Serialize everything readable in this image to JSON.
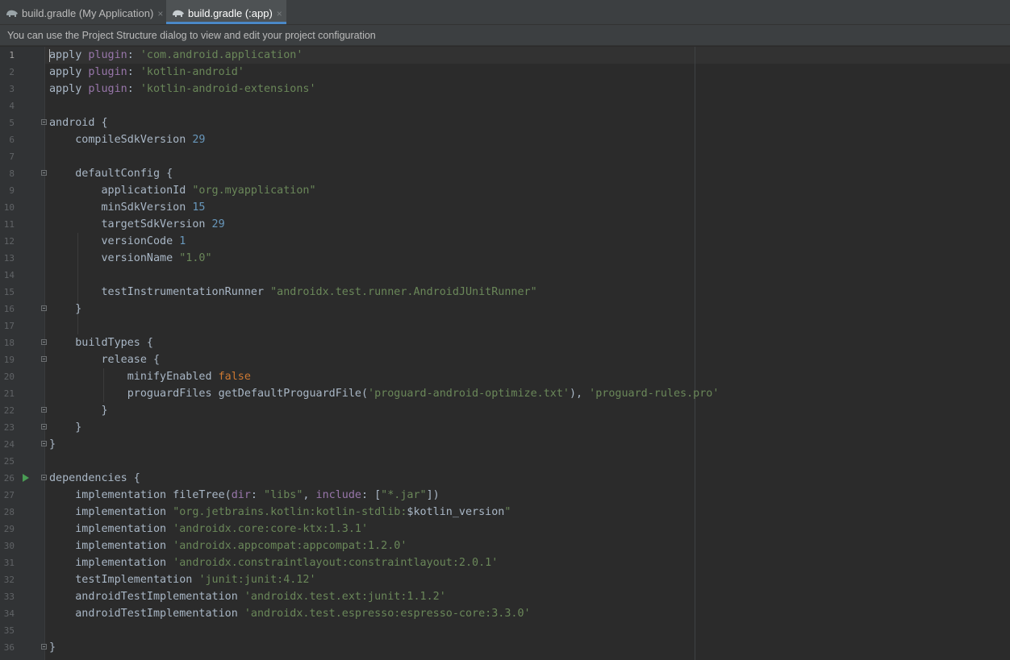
{
  "tabs": [
    {
      "label": "build.gradle (My Application)",
      "icon": "gradle-elephant-icon",
      "active": false
    },
    {
      "label": "build.gradle (:app)",
      "icon": "gradle-elephant-icon",
      "active": true
    }
  ],
  "tab_close_glyph": "×",
  "notification": "You can use the Project Structure dialog to view and edit your project configuration",
  "colors": {
    "background": "#2b2b2b",
    "keyword": "#cc7832",
    "string": "#6a8759",
    "number": "#6897bb",
    "parameter": "#9876aa",
    "active_tab_underline": "#4a88c7",
    "run_marker": "#499c54"
  },
  "editor": {
    "current_line": 1,
    "lines": [
      {
        "n": "1",
        "tokens": [
          {
            "t": "apply "
          },
          {
            "t": "plugin",
            "c": "par"
          },
          {
            "t": ": "
          },
          {
            "t": "'com.android.application'",
            "c": "str"
          }
        ]
      },
      {
        "n": "2",
        "tokens": [
          {
            "t": "apply "
          },
          {
            "t": "plugin",
            "c": "par"
          },
          {
            "t": ": "
          },
          {
            "t": "'kotlin-android'",
            "c": "str"
          }
        ]
      },
      {
        "n": "3",
        "tokens": [
          {
            "t": "apply "
          },
          {
            "t": "plugin",
            "c": "par"
          },
          {
            "t": ": "
          },
          {
            "t": "'kotlin-android-extensions'",
            "c": "str"
          }
        ]
      },
      {
        "n": "4",
        "tokens": []
      },
      {
        "n": "5",
        "fold": true,
        "tokens": [
          {
            "t": "android {"
          }
        ]
      },
      {
        "n": "6",
        "tokens": [
          {
            "t": "    compileSdkVersion "
          },
          {
            "t": "29",
            "c": "num"
          }
        ]
      },
      {
        "n": "7",
        "tokens": []
      },
      {
        "n": "8",
        "fold": true,
        "tokens": [
          {
            "t": "    defaultConfig {"
          }
        ]
      },
      {
        "n": "9",
        "tokens": [
          {
            "t": "        applicationId "
          },
          {
            "t": "\"org.myapplication\"",
            "c": "str"
          }
        ]
      },
      {
        "n": "10",
        "tokens": [
          {
            "t": "        minSdkVersion "
          },
          {
            "t": "15",
            "c": "num"
          }
        ]
      },
      {
        "n": "11",
        "tokens": [
          {
            "t": "        targetSdkVersion "
          },
          {
            "t": "29",
            "c": "num"
          }
        ]
      },
      {
        "n": "12",
        "tokens": [
          {
            "t": "        versionCode "
          },
          {
            "t": "1",
            "c": "num"
          }
        ]
      },
      {
        "n": "13",
        "tokens": [
          {
            "t": "        versionName "
          },
          {
            "t": "\"1.0\"",
            "c": "str"
          }
        ]
      },
      {
        "n": "14",
        "tokens": []
      },
      {
        "n": "15",
        "tokens": [
          {
            "t": "        testInstrumentationRunner "
          },
          {
            "t": "\"androidx.test.runner.AndroidJUnitRunner\"",
            "c": "str"
          }
        ]
      },
      {
        "n": "16",
        "fold": true,
        "tokens": [
          {
            "t": "    }"
          }
        ]
      },
      {
        "n": "17",
        "tokens": []
      },
      {
        "n": "18",
        "fold": true,
        "tokens": [
          {
            "t": "    buildTypes {"
          }
        ]
      },
      {
        "n": "19",
        "fold": true,
        "tokens": [
          {
            "t": "        release {"
          }
        ]
      },
      {
        "n": "20",
        "tokens": [
          {
            "t": "            minifyEnabled "
          },
          {
            "t": "false",
            "c": "kw"
          }
        ]
      },
      {
        "n": "21",
        "tokens": [
          {
            "t": "            proguardFiles getDefaultProguardFile("
          },
          {
            "t": "'proguard-android-optimize.txt'",
            "c": "str"
          },
          {
            "t": "), "
          },
          {
            "t": "'proguard-rules.pro'",
            "c": "str"
          }
        ]
      },
      {
        "n": "22",
        "fold": true,
        "tokens": [
          {
            "t": "        }"
          }
        ]
      },
      {
        "n": "23",
        "fold": true,
        "tokens": [
          {
            "t": "    }"
          }
        ]
      },
      {
        "n": "24",
        "fold": true,
        "tokens": [
          {
            "t": "}"
          }
        ]
      },
      {
        "n": "25",
        "tokens": []
      },
      {
        "n": "26",
        "fold": true,
        "run": true,
        "tokens": [
          {
            "t": "dependencies {"
          }
        ]
      },
      {
        "n": "27",
        "tokens": [
          {
            "t": "    implementation fileTree("
          },
          {
            "t": "dir",
            "c": "par"
          },
          {
            "t": ": "
          },
          {
            "t": "\"libs\"",
            "c": "str"
          },
          {
            "t": ", "
          },
          {
            "t": "include",
            "c": "par"
          },
          {
            "t": ": ["
          },
          {
            "t": "\"*.jar\"",
            "c": "str"
          },
          {
            "t": "])"
          }
        ]
      },
      {
        "n": "28",
        "tokens": [
          {
            "t": "    implementation "
          },
          {
            "t": "\"org.jetbrains.kotlin:kotlin-stdlib:",
            "c": "str"
          },
          {
            "t": "$kotlin_version",
            "c": "nm"
          },
          {
            "t": "\"",
            "c": "str"
          }
        ]
      },
      {
        "n": "29",
        "tokens": [
          {
            "t": "    implementation "
          },
          {
            "t": "'androidx.core:core-ktx:1.3.1'",
            "c": "str"
          }
        ]
      },
      {
        "n": "30",
        "tokens": [
          {
            "t": "    implementation "
          },
          {
            "t": "'androidx.appcompat:appcompat:1.2.0'",
            "c": "str"
          }
        ]
      },
      {
        "n": "31",
        "tokens": [
          {
            "t": "    implementation "
          },
          {
            "t": "'androidx.constraintlayout:constraintlayout:2.0.1'",
            "c": "str"
          }
        ]
      },
      {
        "n": "32",
        "tokens": [
          {
            "t": "    testImplementation "
          },
          {
            "t": "'junit:junit:4.12'",
            "c": "str"
          }
        ]
      },
      {
        "n": "33",
        "tokens": [
          {
            "t": "    androidTestImplementation "
          },
          {
            "t": "'androidx.test.ext:junit:1.1.2'",
            "c": "str"
          }
        ]
      },
      {
        "n": "34",
        "tokens": [
          {
            "t": "    androidTestImplementation "
          },
          {
            "t": "'androidx.test.espresso:espresso-core:3.3.0'",
            "c": "str"
          }
        ]
      },
      {
        "n": "35",
        "tokens": []
      },
      {
        "n": "36",
        "fold": true,
        "tokens": [
          {
            "t": "}"
          }
        ]
      }
    ]
  }
}
